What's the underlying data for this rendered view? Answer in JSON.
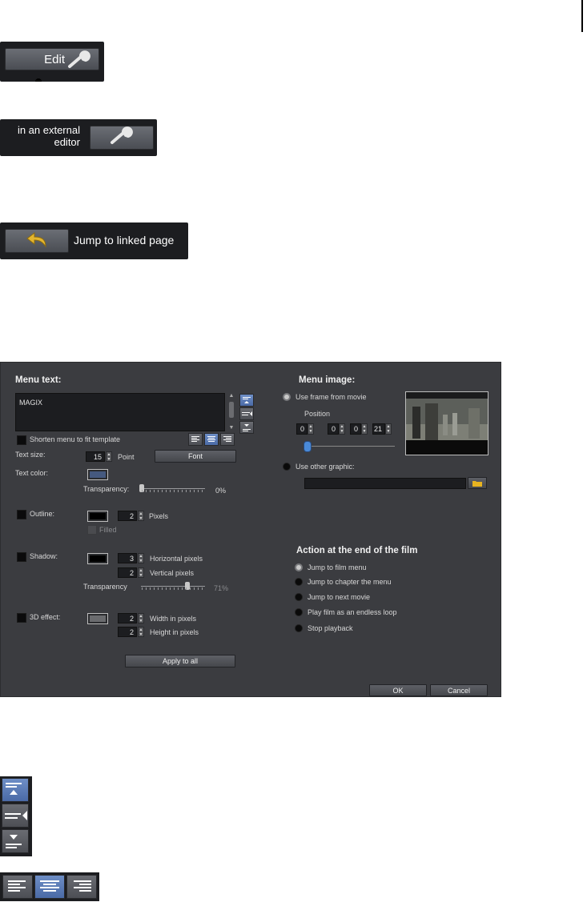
{
  "top_buttons": {
    "edit_label": "Edit",
    "external_editor_label": "in an external\neditor",
    "jump_label": "Jump to linked page"
  },
  "dialog": {
    "menu_text": {
      "title": "Menu text:",
      "value": "MAGIX",
      "shorten_label": "Shorten menu to fit template",
      "text_size_label": "Text size:",
      "text_size_value": "15",
      "point_label": "Point",
      "font_button": "Font",
      "text_color_label": "Text color:",
      "transparency_label": "Transparency:",
      "transparency_value": "0%",
      "outline_label": "Outline:",
      "outline_pixels_value": "2",
      "pixels_label": "Pixels",
      "filled_label": "Filled",
      "shadow_label": "Shadow:",
      "shadow_h_value": "3",
      "shadow_h_label": "Horizontal pixels",
      "shadow_v_value": "2",
      "shadow_v_label": "Vertical pixels",
      "shadow_transparency_label": "Transparency",
      "shadow_transparency_value": "71%",
      "effect3d_label": "3D effect:",
      "width_value": "2",
      "width_label": "Width in pixels",
      "height_value": "2",
      "height_label": "Height in pixels",
      "apply_button": "Apply to all"
    },
    "menu_image": {
      "title": "Menu image:",
      "use_frame_label": "Use frame from movie",
      "position_label": "Position",
      "pos_values": [
        "0",
        "0",
        "0",
        "21"
      ],
      "use_other_label": "Use other graphic:",
      "graphic_path": ""
    },
    "end_action": {
      "title": "Action at the end of the film",
      "options": [
        "Jump to film menu",
        "Jump to chapter the menu",
        "Jump to next movie",
        "Play film as an endless loop",
        "Stop playback"
      ],
      "selected_index": 0
    },
    "ok_button": "OK",
    "cancel_button": "Cancel"
  },
  "icons": {
    "vertical_align": [
      "align-top-icon",
      "align-middle-icon",
      "align-bottom-icon"
    ],
    "horizontal_align": [
      "align-left-icon",
      "align-center-icon",
      "align-right-icon"
    ],
    "accent_color": "#5a7ab8"
  }
}
